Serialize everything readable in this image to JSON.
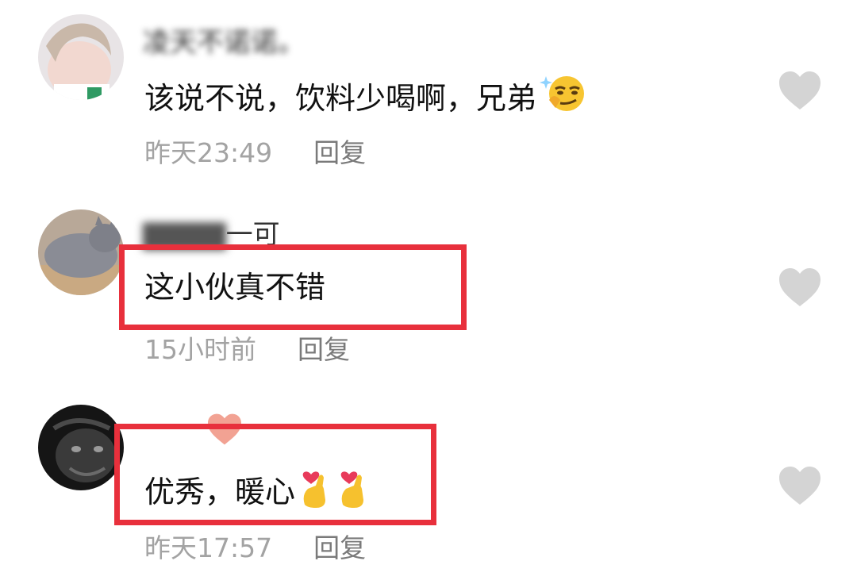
{
  "comments": [
    {
      "username": "凌天不诺诺。",
      "text": "该说不说，饮料少喝啊，兄弟",
      "emoji": "smirk-emoji",
      "time": "昨天23:49",
      "reply": "回复"
    },
    {
      "username": "一可",
      "text": "这小伙真不错",
      "time": "15小时前",
      "reply": "回复"
    },
    {
      "username": "",
      "text": "优秀，暖心",
      "emoji": "finger-heart-emoji",
      "time": "昨天17:57",
      "reply": "回复"
    }
  ],
  "colors": {
    "highlight": "#e8303c",
    "like_icon": "#d4d4d4",
    "meta_text": "#a3a3a3"
  }
}
